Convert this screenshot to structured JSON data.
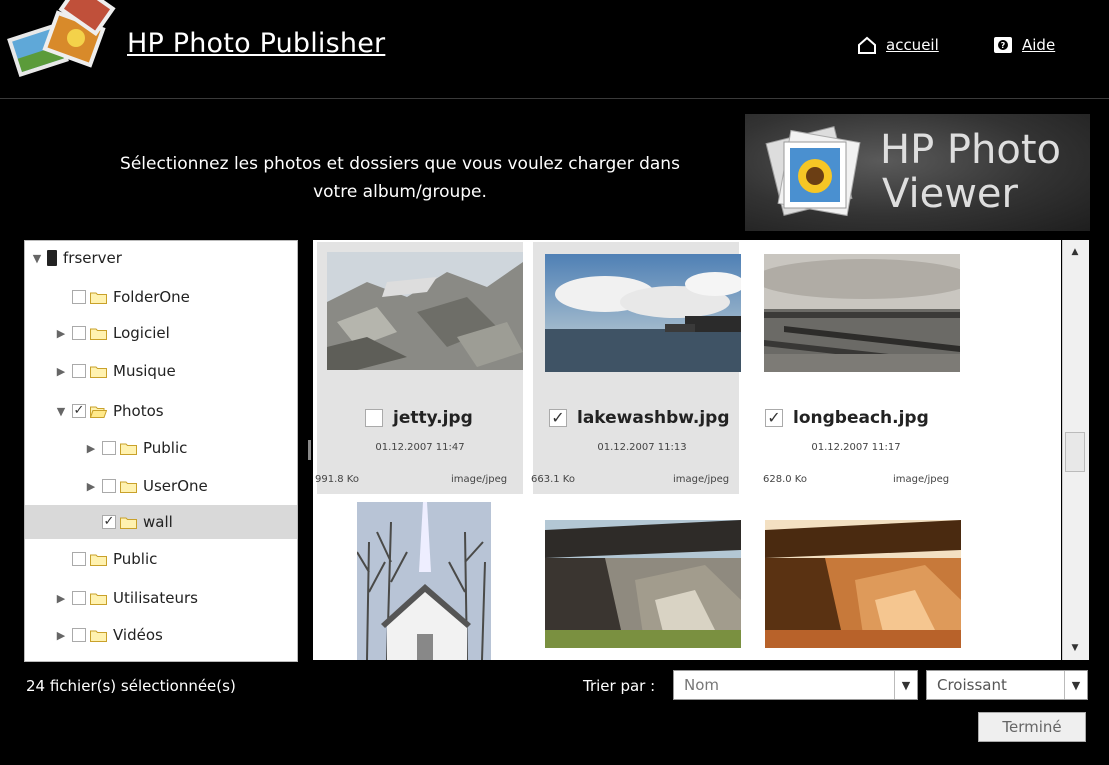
{
  "app": {
    "title": "HP Photo Publisher"
  },
  "nav": {
    "home_label": "accueil",
    "help_label": "Aide"
  },
  "instruction": {
    "line1": "Sélectionnez les photos et dossiers que vous voulez charger dans",
    "line2": "votre album/groupe."
  },
  "banner": {
    "line1": "HP Photo",
    "line2": "Viewer"
  },
  "tree": [
    {
      "label": "frserver",
      "arrow": "▼",
      "checked": false,
      "type": "server"
    },
    {
      "label": "FolderOne",
      "arrow": "",
      "checked": false,
      "type": "folder"
    },
    {
      "label": "Logiciel",
      "arrow": "▶",
      "checked": false,
      "type": "folder"
    },
    {
      "label": "Musique",
      "arrow": "▶",
      "checked": false,
      "type": "folder"
    },
    {
      "label": "Photos",
      "arrow": "▼",
      "checked": true,
      "type": "folder-open"
    },
    {
      "label": "Public",
      "arrow": "▶",
      "checked": false,
      "type": "folder"
    },
    {
      "label": "UserOne",
      "arrow": "▶",
      "checked": false,
      "type": "folder"
    },
    {
      "label": "wall",
      "arrow": "",
      "checked": true,
      "type": "folder",
      "selected": true
    },
    {
      "label": "Public",
      "arrow": "",
      "checked": false,
      "type": "folder"
    },
    {
      "label": "Utilisateurs",
      "arrow": "▶",
      "checked": false,
      "type": "folder"
    },
    {
      "label": "Vidéos",
      "arrow": "▶",
      "checked": false,
      "type": "folder"
    }
  ],
  "photos": [
    {
      "name": "jetty.jpg",
      "checked": false,
      "date": "01.12.2007 11:47",
      "size": "991.8 Ko",
      "type": "image/jpeg"
    },
    {
      "name": "lakewashbw.jpg",
      "checked": true,
      "date": "01.12.2007 11:13",
      "size": "663.1 Ko",
      "type": "image/jpeg"
    },
    {
      "name": "longbeach.jpg",
      "checked": true,
      "date": "01.12.2007 11:17",
      "size": "628.0 Ko",
      "type": "image/jpeg"
    }
  ],
  "footer": {
    "status": "24 fichier(s) sélectionnée(s)",
    "sort_label": "Trier par :",
    "sort_value": "Nom",
    "order_value": "Croissant",
    "done_label": "Terminé"
  }
}
